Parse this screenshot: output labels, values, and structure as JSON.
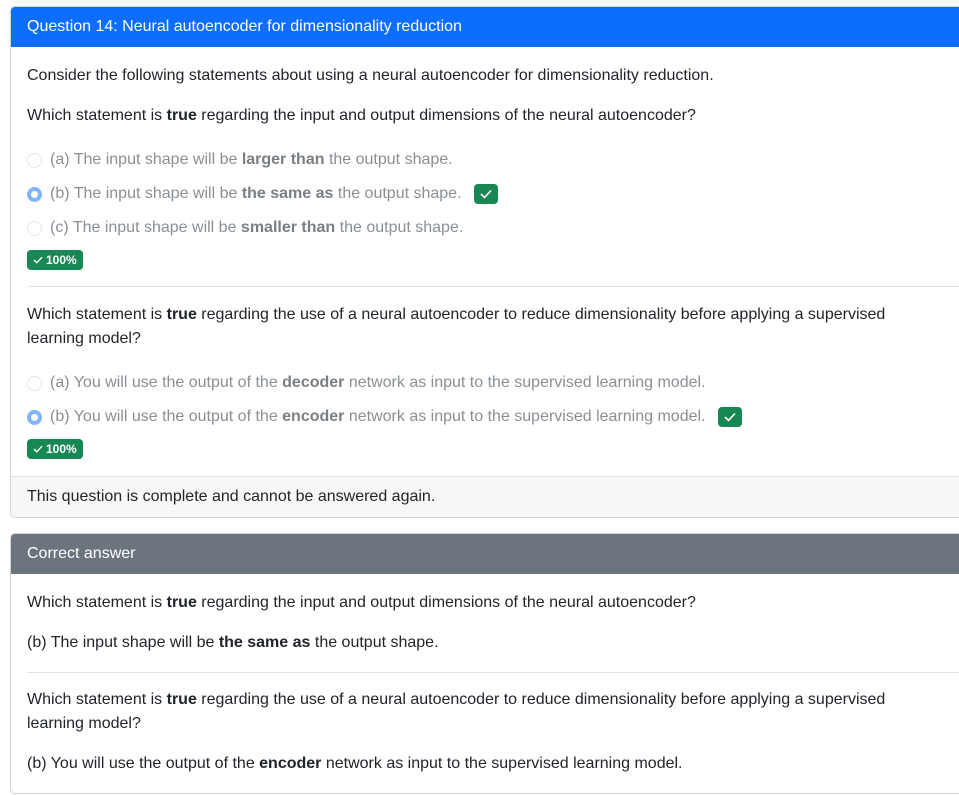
{
  "question": {
    "header": "Question 14: Neural autoencoder for dimensionality reduction",
    "intro": "Consider the following statements about using a neural autoencoder for dimensionality reduction.",
    "part1": {
      "prompt_pre": "Which statement is ",
      "prompt_bold": "true",
      "prompt_post": " regarding the input and output dimensions of the neural autoencoder?",
      "options": [
        {
          "pre": "(a) The input shape will be ",
          "bold": "larger than",
          "post": " the output shape.",
          "selected": false
        },
        {
          "pre": "(b) The input shape will be ",
          "bold": "the same as",
          "post": " the output shape.",
          "selected": true
        },
        {
          "pre": "(c) The input shape will be ",
          "bold": "smaller than",
          "post": " the output shape.",
          "selected": false
        }
      ],
      "score": "100%"
    },
    "part2": {
      "prompt_pre": "Which statement is ",
      "prompt_bold": "true",
      "prompt_post": " regarding the use of a neural autoencoder to reduce dimensionality before applying a supervised learning model?",
      "options": [
        {
          "pre": "(a) You will use the output of the ",
          "bold": "decoder",
          "post": " network as input to the supervised learning model.",
          "selected": false
        },
        {
          "pre": "(b) You will use the output of the ",
          "bold": "encoder",
          "post": " network as input to the supervised learning model.",
          "selected": true
        }
      ],
      "score": "100%"
    },
    "footer": "This question is complete and cannot be answered again."
  },
  "answer": {
    "header": "Correct answer",
    "part1": {
      "prompt_pre": "Which statement is ",
      "prompt_bold": "true",
      "prompt_post": " regarding the input and output dimensions of the neural autoencoder?",
      "answer_pre": "(b) The input shape will be ",
      "answer_bold": "the same as",
      "answer_post": " the output shape."
    },
    "part2": {
      "prompt_pre": "Which statement is ",
      "prompt_bold": "true",
      "prompt_post": " regarding the use of a neural autoencoder to reduce dimensionality before applying a supervised learning model?",
      "answer_pre": "(b) You will use the output of the ",
      "answer_bold": "encoder",
      "answer_post": " network as input to the supervised learning model."
    }
  },
  "colors": {
    "header_blue": "#0d6efd",
    "header_gray": "#6c757d",
    "success_green": "#198754",
    "radio_selected": "#82b4f8"
  },
  "icons": [
    "check-icon",
    "radio-icon"
  ]
}
